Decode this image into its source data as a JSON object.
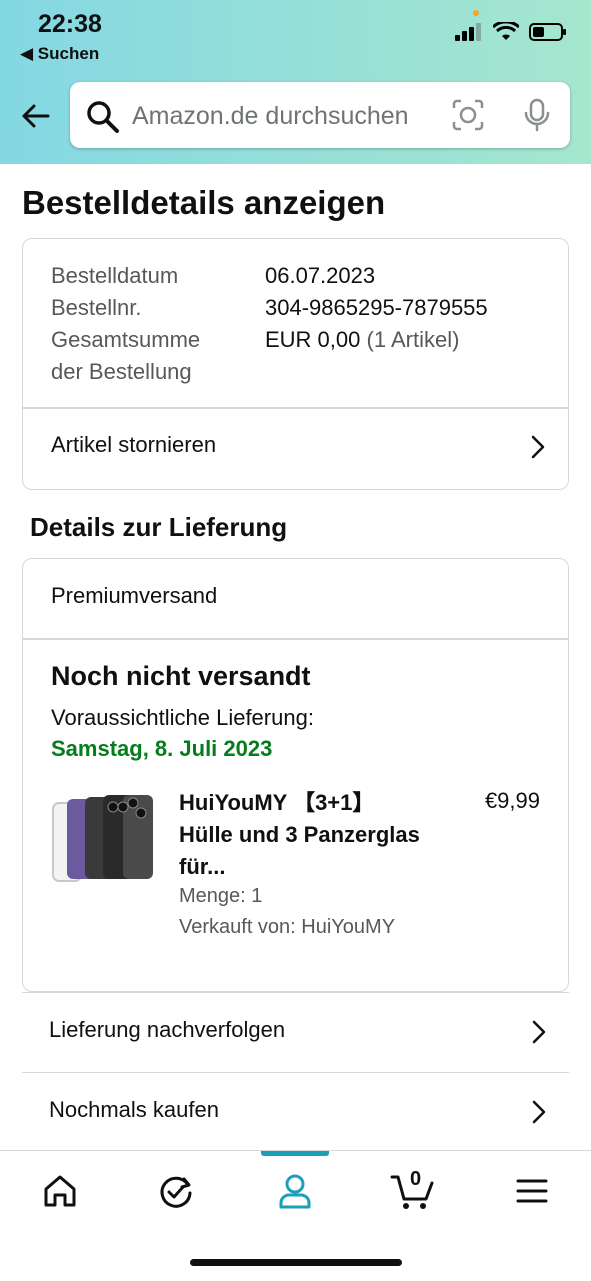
{
  "status_bar": {
    "time": "22:38",
    "back_app": "◀ Suchen"
  },
  "search": {
    "placeholder": "Amazon.de durchsuchen"
  },
  "page_title": "Bestelldetails anzeigen",
  "order": {
    "date_label": "Bestelldatum",
    "date_value": "06.07.2023",
    "number_label": "Bestellnr.",
    "number_value": "304-9865295-7879555",
    "total_label_line1": "Gesamtsumme",
    "total_label_line2": "der Bestellung",
    "total_value": "EUR 0,00",
    "total_items": "(1 Artikel)",
    "cancel_label": "Artikel stornieren"
  },
  "delivery": {
    "section_title": "Details zur Lieferung",
    "shipping_method": "Premiumversand",
    "status": "Noch nicht versandt",
    "expected_label": "Voraussichtliche Lieferung:",
    "expected_date": "Samstag, 8. Juli 2023",
    "item": {
      "title": "HuiYouMY 【3+1】 Hülle und 3 Panzerglas für...",
      "price": "€9,99",
      "quantity": "Menge: 1",
      "seller": "Verkauft von: HuiYouMY"
    }
  },
  "links": {
    "track": "Lieferung nachverfolgen",
    "buy_again": "Nochmals kaufen"
  },
  "bottom_nav": {
    "items": [
      "home-icon",
      "refresh-check-icon",
      "account-icon",
      "cart-icon",
      "menu-icon"
    ],
    "cart_count": "0",
    "accent_color": "#1a9fb5"
  },
  "colors": {
    "delivery_date_green": "#067d1b",
    "header_gradient_start": "#84d8e3",
    "header_gradient_end": "#a5e6ce"
  }
}
